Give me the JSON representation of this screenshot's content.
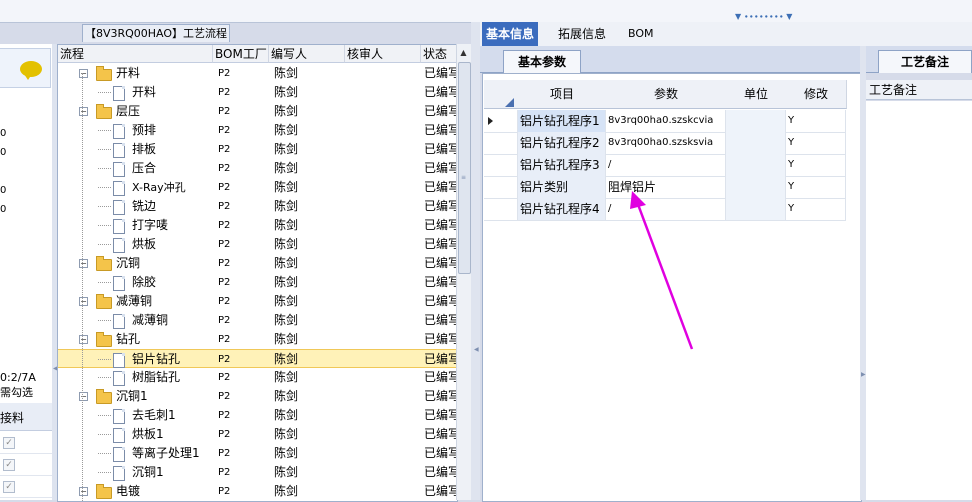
{
  "process_panel": {
    "title": "【8V3RQ00HAO】工艺流程",
    "columns": [
      "流程",
      "BOM工厂",
      "编写人",
      "核审人",
      "状态"
    ],
    "rows": [
      {
        "name": "开料",
        "type": "folder",
        "level": 1,
        "factory": "P2",
        "writer": "陈剑",
        "reviewer": "",
        "status": "已编写"
      },
      {
        "name": "开料",
        "type": "doc",
        "level": 2,
        "factory": "P2",
        "writer": "陈剑",
        "reviewer": "",
        "status": "已编写"
      },
      {
        "name": "层压",
        "type": "folder",
        "level": 1,
        "factory": "P2",
        "writer": "陈剑",
        "reviewer": "",
        "status": "已编写"
      },
      {
        "name": "预排",
        "type": "doc",
        "level": 2,
        "factory": "P2",
        "writer": "陈剑",
        "reviewer": "",
        "status": "已编写"
      },
      {
        "name": "排板",
        "type": "doc",
        "level": 2,
        "factory": "P2",
        "writer": "陈剑",
        "reviewer": "",
        "status": "已编写"
      },
      {
        "name": "压合",
        "type": "doc",
        "level": 2,
        "factory": "P2",
        "writer": "陈剑",
        "reviewer": "",
        "status": "已编写"
      },
      {
        "name": "X-Ray冲孔",
        "type": "doc",
        "level": 2,
        "factory": "P2",
        "writer": "陈剑",
        "reviewer": "",
        "status": "已编写"
      },
      {
        "name": "铣边",
        "type": "doc",
        "level": 2,
        "factory": "P2",
        "writer": "陈剑",
        "reviewer": "",
        "status": "已编写"
      },
      {
        "name": "打字唛",
        "type": "doc",
        "level": 2,
        "factory": "P2",
        "writer": "陈剑",
        "reviewer": "",
        "status": "已编写"
      },
      {
        "name": "烘板",
        "type": "doc",
        "level": 2,
        "factory": "P2",
        "writer": "陈剑",
        "reviewer": "",
        "status": "已编写"
      },
      {
        "name": "沉铜",
        "type": "folder",
        "level": 1,
        "factory": "P2",
        "writer": "陈剑",
        "reviewer": "",
        "status": "已编写"
      },
      {
        "name": "除胶",
        "type": "doc",
        "level": 2,
        "factory": "P2",
        "writer": "陈剑",
        "reviewer": "",
        "status": "已编写"
      },
      {
        "name": "减薄铜",
        "type": "folder",
        "level": 1,
        "factory": "P2",
        "writer": "陈剑",
        "reviewer": "",
        "status": "已编写"
      },
      {
        "name": "减薄铜",
        "type": "doc",
        "level": 2,
        "factory": "P2",
        "writer": "陈剑",
        "reviewer": "",
        "status": "已编写"
      },
      {
        "name": "钻孔",
        "type": "folder",
        "level": 1,
        "factory": "P2",
        "writer": "陈剑",
        "reviewer": "",
        "status": "已编写"
      },
      {
        "name": "铝片钻孔",
        "type": "doc",
        "level": 2,
        "factory": "P2",
        "writer": "陈剑",
        "reviewer": "",
        "status": "已编写",
        "selected": true
      },
      {
        "name": "树脂钻孔",
        "type": "doc",
        "level": 2,
        "factory": "P2",
        "writer": "陈剑",
        "reviewer": "",
        "status": "已编写"
      },
      {
        "name": "沉铜1",
        "type": "folder",
        "level": 1,
        "factory": "P2",
        "writer": "陈剑",
        "reviewer": "",
        "status": "已编写"
      },
      {
        "name": "去毛刺1",
        "type": "doc",
        "level": 2,
        "factory": "P2",
        "writer": "陈剑",
        "reviewer": "",
        "status": "已编写"
      },
      {
        "name": "烘板1",
        "type": "doc",
        "level": 2,
        "factory": "P2",
        "writer": "陈剑",
        "reviewer": "",
        "status": "已编写"
      },
      {
        "name": "等离子处理1",
        "type": "doc",
        "level": 2,
        "factory": "P2",
        "writer": "陈剑",
        "reviewer": "",
        "status": "已编写"
      },
      {
        "name": "沉铜1",
        "type": "doc",
        "level": 2,
        "factory": "P2",
        "writer": "陈剑",
        "reviewer": "",
        "status": "已编写"
      },
      {
        "name": "电镀",
        "type": "folder",
        "level": 1,
        "factory": "P2",
        "writer": "陈剑",
        "reviewer": "",
        "status": "已编写"
      }
    ]
  },
  "left_panel": {
    "zeros": [
      "0",
      "0",
      "0",
      "0"
    ],
    "info_line1": "0:2/7A",
    "info_line2": "需勾选",
    "grid_header": "接料",
    "checks": [
      "✓",
      "✓",
      "✓"
    ]
  },
  "main_tabs": [
    "基本信息",
    "拓展信息",
    "BOM"
  ],
  "params_panel": {
    "tab_label": "基本参数",
    "columns": [
      "项目",
      "参数",
      "单位",
      "修改"
    ],
    "rows": [
      {
        "item": "铝片钻孔程序1",
        "param": "8v3rq00ha0.szskcvia",
        "unit": "",
        "modify": "Y"
      },
      {
        "item": "铝片钻孔程序2",
        "param": "8v3rq00ha0.szsksvia",
        "unit": "",
        "modify": "Y"
      },
      {
        "item": "铝片钻孔程序3",
        "param": "/",
        "unit": "",
        "modify": "Y"
      },
      {
        "item": "铝片类别",
        "param": "阻焊铝片",
        "unit": "",
        "modify": "Y"
      },
      {
        "item": "铝片钻孔程序4",
        "param": "/",
        "unit": "",
        "modify": "Y"
      }
    ]
  },
  "notes_panel": {
    "tab_label": "工艺备注",
    "header": "工艺备注"
  },
  "colors": {
    "accent": "#3b6cbe",
    "selection": "#fff2b8",
    "annotation_arrow": "#e000e0"
  }
}
